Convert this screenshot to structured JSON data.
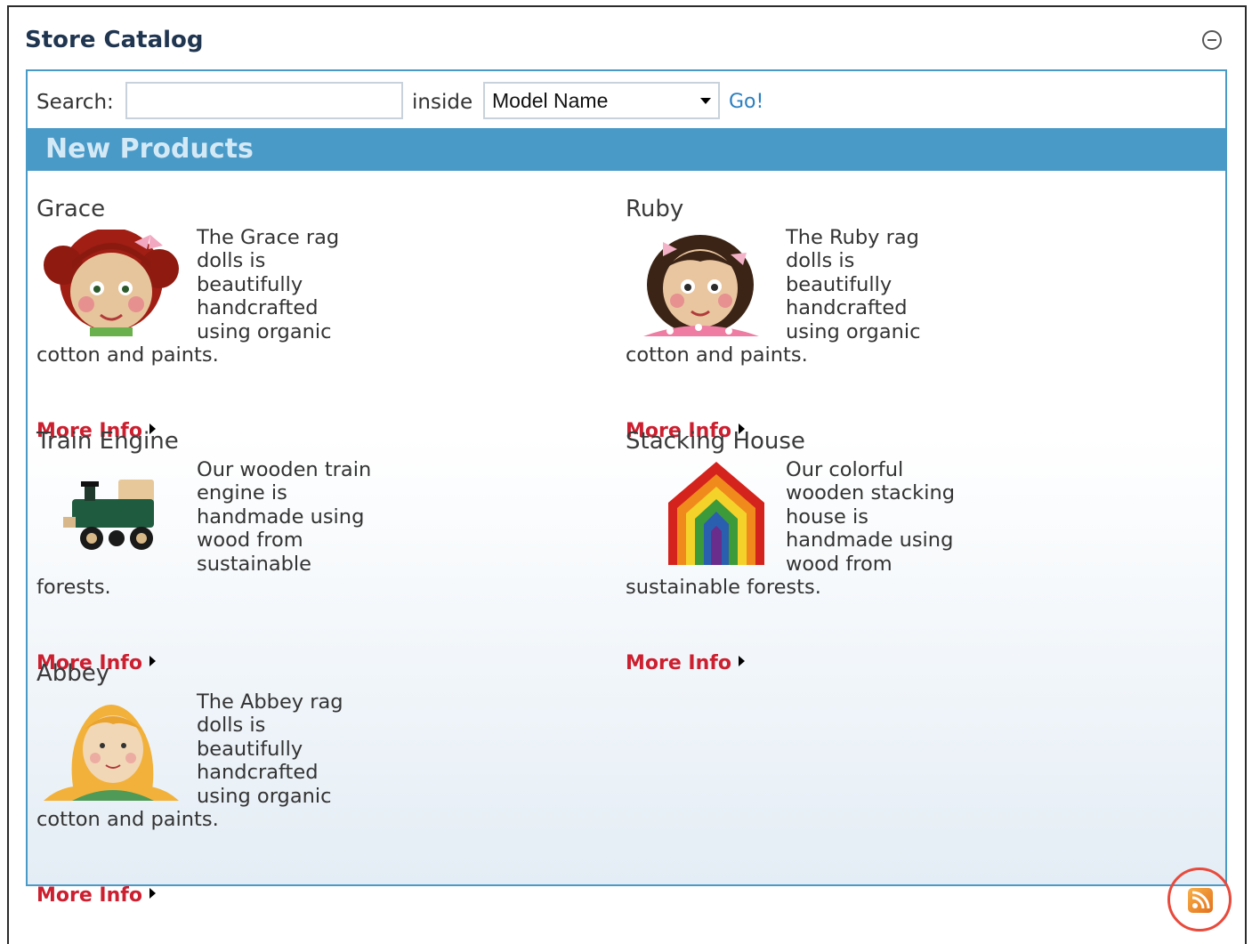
{
  "widget": {
    "title": "Store Catalog"
  },
  "search": {
    "label": "Search:",
    "value": "",
    "inside_label": "inside",
    "field": "Model Name",
    "go_label": "Go!"
  },
  "section": {
    "title": "New Products"
  },
  "products": [
    {
      "name": "Grace",
      "description": "The Grace rag dolls is beautifully handcrafted using organic cotton and paints.",
      "more_label": "More Info"
    },
    {
      "name": "Ruby",
      "description": "The Ruby rag dolls is beautifully handcrafted using organic cotton and paints.",
      "more_label": "More Info"
    },
    {
      "name": "Train Engine",
      "description": "Our wooden train engine is handmade using wood from sustainable forests.",
      "more_label": "More Info"
    },
    {
      "name": "Stacking House",
      "description": "Our colorful wooden stacking house is handmade using wood from sustainable forests.",
      "more_label": "More Info"
    },
    {
      "name": "Abbey",
      "description": "The Abbey rag dolls is beautifully handcrafted using organic cotton and paints.",
      "more_label": "More Info"
    }
  ],
  "icons": {
    "collapse": "collapse-icon",
    "rss": "rss-icon"
  },
  "colors": {
    "accent": "#4a9ac8",
    "link_red": "#cc1f2f",
    "link_blue": "#2a7fc0",
    "rss": "#e2711b",
    "highlight_circle": "#e84a3c"
  }
}
